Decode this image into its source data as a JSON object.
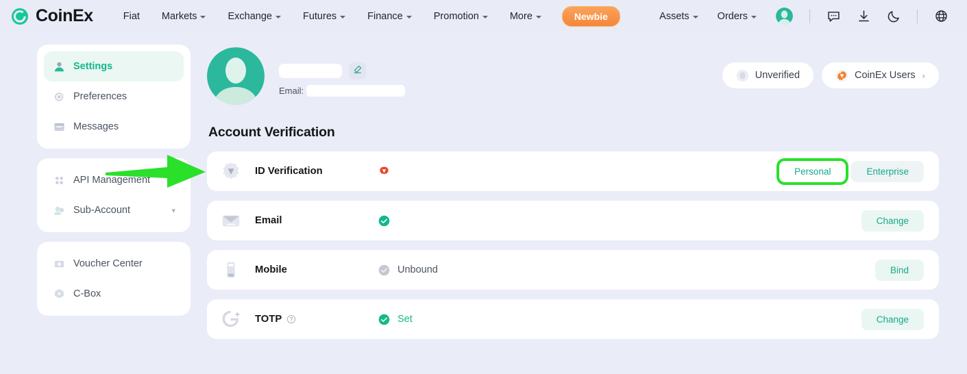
{
  "brand": {
    "name": "CoinEx",
    "logo_icon": "coinex-logo-icon"
  },
  "topnav": {
    "links": [
      {
        "label": "Fiat",
        "has_caret": false
      },
      {
        "label": "Markets",
        "has_caret": true
      },
      {
        "label": "Exchange",
        "has_caret": true
      },
      {
        "label": "Futures",
        "has_caret": true
      },
      {
        "label": "Finance",
        "has_caret": true
      },
      {
        "label": "Promotion",
        "has_caret": true
      },
      {
        "label": "More",
        "has_caret": true
      }
    ],
    "newbie_label": "Newbie",
    "right_links": [
      {
        "label": "Assets",
        "has_caret": true
      },
      {
        "label": "Orders",
        "has_caret": true
      }
    ],
    "icons": [
      {
        "name": "chat-icon"
      },
      {
        "name": "download-icon"
      },
      {
        "name": "moon-icon"
      },
      {
        "name": "globe-icon"
      }
    ]
  },
  "sidebar": {
    "groups": [
      {
        "items": [
          {
            "label": "Settings",
            "icon": "user-settings-icon",
            "active": true,
            "chevron": false
          },
          {
            "label": "Preferences",
            "icon": "preferences-icon",
            "active": false,
            "chevron": false
          },
          {
            "label": "Messages",
            "icon": "messages-icon",
            "active": false,
            "chevron": false
          }
        ]
      },
      {
        "items": [
          {
            "label": "API Management",
            "icon": "api-icon",
            "active": false,
            "chevron": false
          },
          {
            "label": "Sub-Account",
            "icon": "sub-account-icon",
            "active": false,
            "chevron": true
          }
        ]
      },
      {
        "items": [
          {
            "label": "Voucher Center",
            "icon": "voucher-icon",
            "active": false,
            "chevron": false
          },
          {
            "label": "C-Box",
            "icon": "cbox-icon",
            "active": false,
            "chevron": false
          }
        ]
      }
    ]
  },
  "profile": {
    "avatar_icon": "user-avatar",
    "username": "",
    "username_redacted": true,
    "edit_icon": "edit-pencil-icon",
    "email_label": "Email:",
    "email_value": "",
    "email_redacted": true,
    "badges": [
      {
        "label": "Unverified",
        "icon": "shield-grey-icon",
        "chevron": ""
      },
      {
        "label": "CoinEx Users",
        "icon": "shield-orange-icon",
        "chevron": "›"
      }
    ]
  },
  "account_verification": {
    "title": "Account Verification",
    "rows": [
      {
        "label": "ID Verification",
        "icon": "id-verification-icon",
        "status_icon": "unverified-red-icon",
        "status_text": "",
        "status_ok": false,
        "help": false,
        "actions": [
          {
            "label": "Personal",
            "style": "highlighted"
          },
          {
            "label": "Enterprise",
            "style": "plain"
          }
        ],
        "annotation_arrow": true
      },
      {
        "label": "Email",
        "icon": "email-icon",
        "status_icon": "check-green-icon",
        "status_text": "",
        "status_ok": true,
        "help": false,
        "actions": [
          {
            "label": "Change",
            "style": "normal"
          }
        ],
        "annotation_arrow": false
      },
      {
        "label": "Mobile",
        "icon": "mobile-icon",
        "status_icon": "check-grey-icon",
        "status_text": "Unbound",
        "status_ok": false,
        "help": false,
        "actions": [
          {
            "label": "Bind",
            "style": "normal"
          }
        ],
        "annotation_arrow": false
      },
      {
        "label": "TOTP",
        "icon": "totp-icon",
        "status_icon": "check-green-icon",
        "status_text": "Set",
        "status_ok": true,
        "help": true,
        "actions": [
          {
            "label": "Change",
            "style": "normal"
          }
        ],
        "annotation_arrow": false
      }
    ]
  },
  "colors": {
    "page_bg": "#eaecf7",
    "accent_teal": "#13b88a",
    "annotation_green": "#2ae02a",
    "newbie_orange": "#f4873a",
    "danger_red": "#e8452c"
  }
}
